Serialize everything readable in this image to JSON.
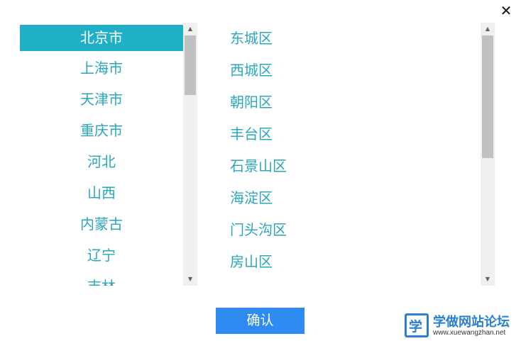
{
  "dialog": {
    "close_symbol": "✕",
    "confirm_label": "确认"
  },
  "provinces": {
    "selected_index": 0,
    "items": [
      "北京市",
      "上海市",
      "天津市",
      "重庆市",
      "河北",
      "山西",
      "内蒙古",
      "辽宁",
      "吉林"
    ]
  },
  "districts": {
    "items": [
      "东城区",
      "西城区",
      "朝阳区",
      "丰台区",
      "石景山区",
      "海淀区",
      "门头沟区",
      "房山区"
    ]
  },
  "scrollbar": {
    "up_symbol": "▲",
    "down_symbol": "▼"
  },
  "watermark": {
    "logo_glyph": "学",
    "title": "学做网站论坛",
    "url": "www.xuewangzhan.net"
  },
  "colors": {
    "accent": "#1fb0c8",
    "item_text": "#2aa7bd",
    "button": "#2e8bf2",
    "watermark": "#2a7fd0"
  }
}
